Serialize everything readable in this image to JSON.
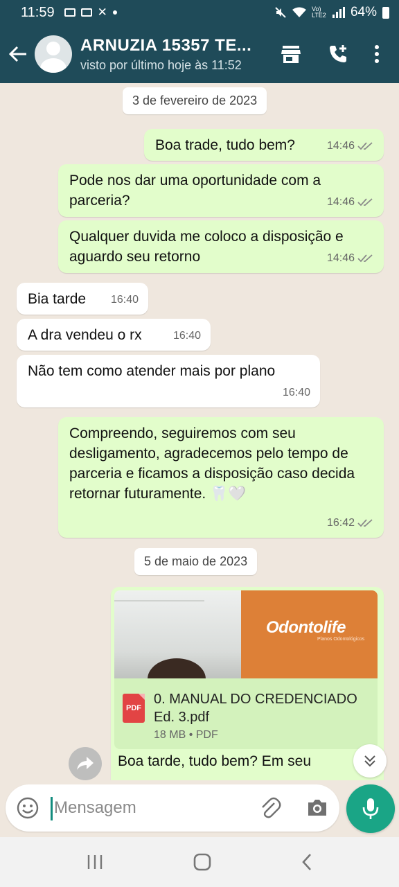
{
  "status_bar": {
    "time": "11:59",
    "battery": "64%",
    "network": "Vo) LTE2"
  },
  "header": {
    "contact_name": "ARNUZIA 15357 TE...",
    "last_seen": "visto por último hoje às 11:52"
  },
  "chat": {
    "date_chips": [
      "3 de fevereiro de 2023",
      "5 de maio de 2023"
    ],
    "messages": [
      {
        "direction": "out",
        "text": "Boa trade, tudo bem?",
        "time": "14:46"
      },
      {
        "direction": "out",
        "text": "Pode nos dar uma oportunidade com a parceria?",
        "time": "14:46"
      },
      {
        "direction": "out",
        "text": "Qualquer duvida me coloco a disposição e aguardo seu retorno",
        "time": "14:46"
      },
      {
        "direction": "in",
        "text": "Bia tarde",
        "time": "16:40"
      },
      {
        "direction": "in",
        "text": "A dra vendeu o rx",
        "time": "16:40"
      },
      {
        "direction": "in",
        "text": "Não tem como atender mais por plano",
        "time": "16:40"
      },
      {
        "direction": "out",
        "text": "Compreendo, seguiremos com seu desligamento, agradecemos pelo tempo de parceria e ficamos a disposição caso decida retornar futuramente. 🦷🤍",
        "time": "16:42"
      }
    ],
    "attachment": {
      "brand": "Odontolife",
      "brand_sub": "Planos Odontológicos",
      "file_name": "0. MANUAL DO CREDENCIADO Ed. 3.pdf",
      "file_meta": "18 MB • PDF",
      "file_type_label": "PDF",
      "caption": "Boa tarde, tudo bem? Em seu"
    }
  },
  "composer": {
    "placeholder": "Mensagem"
  },
  "colors": {
    "header": "#1f4b59",
    "outgoing_bubble": "#e2fdcb",
    "incoming_bubble": "#ffffff",
    "chat_background": "#efe7de",
    "accent": "#1aa586",
    "read_ticks": "#8a8a8a"
  },
  "icons": [
    "back-arrow-icon",
    "store-icon",
    "add-call-icon",
    "more-vert-icon",
    "emoji-icon",
    "attach-clip-icon",
    "camera-icon",
    "mic-icon",
    "forward-icon",
    "chevron-double-down-icon",
    "pdf-icon",
    "recents-icon",
    "home-icon",
    "back-nav-icon"
  ]
}
